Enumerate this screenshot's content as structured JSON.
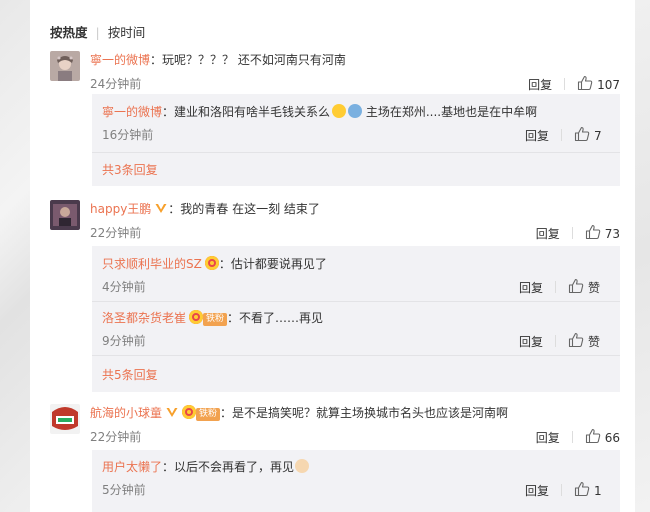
{
  "tabs": {
    "hot": "按热度",
    "time": "按时间"
  },
  "reply_label": "回复",
  "colors": {
    "username": "#eb7350",
    "sub_bg": "#f2f2f5",
    "fan_badge": "#f2a24f"
  },
  "comments": [
    {
      "user": "寧一的微博",
      "text": "：玩呢？？？？ 还不如河南只有河南",
      "time": "24分钟前",
      "likes": "107",
      "replies": [
        {
          "user": "寧一的微博",
          "text": "：建业和洛阳有啥半毛钱关系么",
          "text2": " 主场在郑州....基地也是在中牟啊",
          "time": "16分钟前",
          "likes": "7"
        }
      ],
      "more": "共3条回复"
    },
    {
      "user": "happy王鹏",
      "text": "：我的青春 在这一刻 结束了",
      "time": "22分钟前",
      "likes": "73",
      "replies": [
        {
          "user": "只求顺利毕业的SZ",
          "text": "：估计都要说再见了",
          "time": "4分钟前",
          "likes": "赞"
        },
        {
          "user": "洛圣都杂货老崔",
          "badge": "铁粉",
          "text": "：不看了……再见",
          "time": "9分钟前",
          "likes": "赞"
        }
      ],
      "more": "共5条回复"
    },
    {
      "user": "航海的小球童",
      "badge": "铁粉",
      "text": "：是不是搞笑呢？就算主场换城市名头也应该是河南啊",
      "time": "22分钟前",
      "likes": "66",
      "replies": [
        {
          "user": "用户太懒了",
          "text": "：以后不会再看了，再见",
          "time": "5分钟前",
          "likes": "1"
        }
      ]
    }
  ]
}
